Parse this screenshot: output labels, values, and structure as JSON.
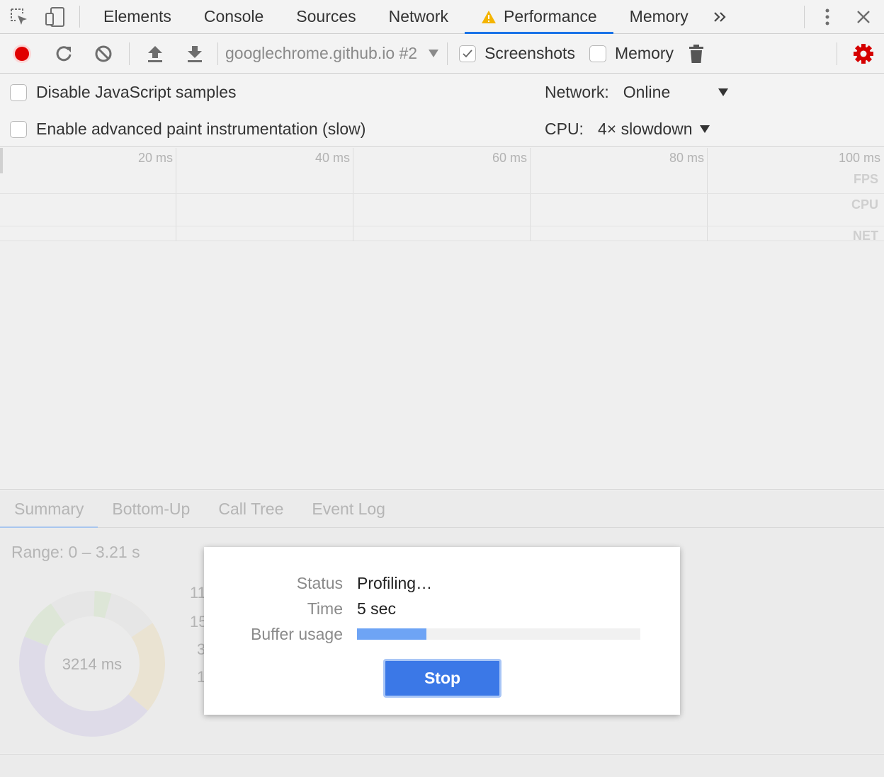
{
  "tabs": [
    {
      "label": "Elements"
    },
    {
      "label": "Console"
    },
    {
      "label": "Sources"
    },
    {
      "label": "Network"
    },
    {
      "label": "Performance"
    },
    {
      "label": "Memory"
    }
  ],
  "toolbar": {
    "target": "googlechrome.github.io #2",
    "screenshots_label": "Screenshots",
    "screenshots_checked": true,
    "memory_label": "Memory",
    "memory_checked": false
  },
  "settings": {
    "disable_js_samples": "Disable JavaScript samples",
    "advanced_paint": "Enable advanced paint instrumentation (slow)",
    "network_label": "Network:",
    "network_value": "Online",
    "cpu_label": "CPU:",
    "cpu_value": "4× slowdown"
  },
  "overview": {
    "ticks": [
      "20 ms",
      "40 ms",
      "60 ms",
      "80 ms",
      "100 ms"
    ],
    "tracks": [
      "FPS",
      "CPU",
      "NET"
    ]
  },
  "bottom": {
    "tabs": [
      "Summary",
      "Bottom-Up",
      "Call Tree",
      "Event Log"
    ],
    "range": "Range: 0 – 3.21 s",
    "total": "3214 ms",
    "partial_labels": [
      "11",
      "15",
      "3",
      "1"
    ]
  },
  "dialog": {
    "status_label": "Status",
    "status_value": "Profiling…",
    "time_label": "Time",
    "time_value": "5 sec",
    "buffer_label": "Buffer usage",
    "buffer_fraction": 0.245,
    "stop_label": "Stop"
  },
  "colors": {
    "record": "#e00000",
    "accent": "#1a73e8",
    "settings_gear": "#d50000",
    "warning": "#f4b400",
    "buffer_fill": "#6ea4f5",
    "stop_button": "#3b78e7"
  },
  "icons": [
    "inspect-icon",
    "device-toggle-icon",
    "warning-icon",
    "more-tabs-icon",
    "kebab-menu-icon",
    "close-icon",
    "record-icon",
    "reload-icon",
    "clear-icon",
    "upload-icon",
    "download-icon",
    "trash-icon",
    "gear-icon"
  ]
}
